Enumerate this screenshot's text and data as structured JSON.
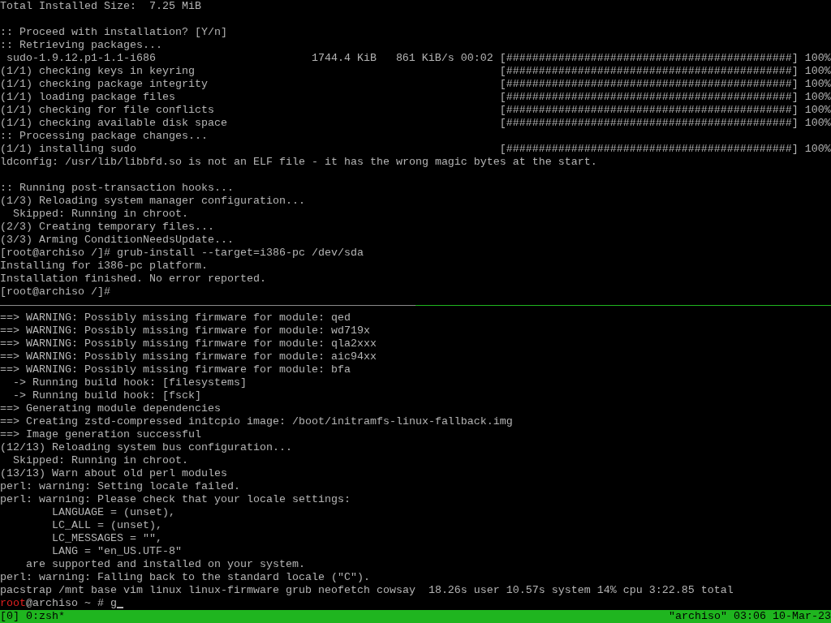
{
  "top_pane": {
    "lines": [
      {
        "kind": "text",
        "text": "Total Installed Size:  7.25 MiB"
      },
      {
        "kind": "blank"
      },
      {
        "kind": "text",
        "text": ":: Proceed with installation? [Y/n]"
      },
      {
        "kind": "text",
        "text": ":: Retrieving packages..."
      },
      {
        "kind": "progress",
        "label": " sudo-1.9.12.p1-1.1-i686",
        "size": "1744.4 KiB",
        "rate": "861 KiB/s",
        "time": "00:02",
        "bar": "[############################################]",
        "percent": "100%"
      },
      {
        "kind": "progress",
        "label": "(1/1) checking keys in keyring",
        "bar": "[############################################]",
        "percent": "100%"
      },
      {
        "kind": "progress",
        "label": "(1/1) checking package integrity",
        "bar": "[############################################]",
        "percent": "100%"
      },
      {
        "kind": "progress",
        "label": "(1/1) loading package files",
        "bar": "[############################################]",
        "percent": "100%"
      },
      {
        "kind": "progress",
        "label": "(1/1) checking for file conflicts",
        "bar": "[############################################]",
        "percent": "100%"
      },
      {
        "kind": "progress",
        "label": "(1/1) checking available disk space",
        "bar": "[############################################]",
        "percent": "100%"
      },
      {
        "kind": "text",
        "text": ":: Processing package changes..."
      },
      {
        "kind": "progress",
        "label": "(1/1) installing sudo",
        "bar": "[############################################]",
        "percent": "100%"
      },
      {
        "kind": "text",
        "text": "ldconfig: /usr/lib/libbfd.so is not an ELF file - it has the wrong magic bytes at the start."
      },
      {
        "kind": "blank"
      },
      {
        "kind": "text",
        "text": ":: Running post-transaction hooks..."
      },
      {
        "kind": "text",
        "text": "(1/3) Reloading system manager configuration..."
      },
      {
        "kind": "text",
        "text": "  Skipped: Running in chroot."
      },
      {
        "kind": "text",
        "text": "(2/3) Creating temporary files..."
      },
      {
        "kind": "text",
        "text": "(3/3) Arming ConditionNeedsUpdate..."
      },
      {
        "kind": "text",
        "text": "[root@archiso /]# grub-install --target=i386-pc /dev/sda"
      },
      {
        "kind": "text",
        "text": "Installing for i386-pc platform."
      },
      {
        "kind": "text",
        "text": "Installation finished. No error reported."
      },
      {
        "kind": "text",
        "text": "[root@archiso /]#"
      }
    ]
  },
  "bottom_pane": {
    "selected": true,
    "lines": [
      {
        "kind": "text",
        "text": "==> WARNING: Possibly missing firmware for module: qed"
      },
      {
        "kind": "text",
        "text": "==> WARNING: Possibly missing firmware for module: wd719x"
      },
      {
        "kind": "text",
        "text": "==> WARNING: Possibly missing firmware for module: qla2xxx"
      },
      {
        "kind": "text",
        "text": "==> WARNING: Possibly missing firmware for module: aic94xx"
      },
      {
        "kind": "text",
        "text": "==> WARNING: Possibly missing firmware for module: bfa"
      },
      {
        "kind": "text",
        "text": "  -> Running build hook: [filesystems]"
      },
      {
        "kind": "text",
        "text": "  -> Running build hook: [fsck]"
      },
      {
        "kind": "text",
        "text": "==> Generating module dependencies"
      },
      {
        "kind": "text",
        "text": "==> Creating zstd-compressed initcpio image: /boot/initramfs-linux-fallback.img"
      },
      {
        "kind": "text",
        "text": "==> Image generation successful"
      },
      {
        "kind": "text",
        "text": "(12/13) Reloading system bus configuration..."
      },
      {
        "kind": "text",
        "text": "  Skipped: Running in chroot."
      },
      {
        "kind": "text",
        "text": "(13/13) Warn about old perl modules"
      },
      {
        "kind": "text",
        "text": "perl: warning: Setting locale failed."
      },
      {
        "kind": "text",
        "text": "perl: warning: Please check that your locale settings:"
      },
      {
        "kind": "text",
        "text": "        LANGUAGE = (unset),"
      },
      {
        "kind": "text",
        "text": "        LC_ALL = (unset),"
      },
      {
        "kind": "text",
        "text": "        LC_MESSAGES = \"\","
      },
      {
        "kind": "text",
        "text": "        LANG = \"en_US.UTF-8\""
      },
      {
        "kind": "text",
        "text": "    are supported and installed on your system."
      },
      {
        "kind": "text",
        "text": "perl: warning: Falling back to the standard locale (\"C\")."
      },
      {
        "kind": "text",
        "text": "pacstrap /mnt base vim linux linux-firmware grub neofetch cowsay  18.26s user 10.57s system 14% cpu 3:22.85 total"
      },
      {
        "kind": "prompt",
        "user": "root",
        "rest": "@archiso ~ # ",
        "input": "g"
      }
    ]
  },
  "status_bar": {
    "windows": "[0] 0:zsh*",
    "info": "\"archiso\" 03:06 10-Mar-23"
  }
}
